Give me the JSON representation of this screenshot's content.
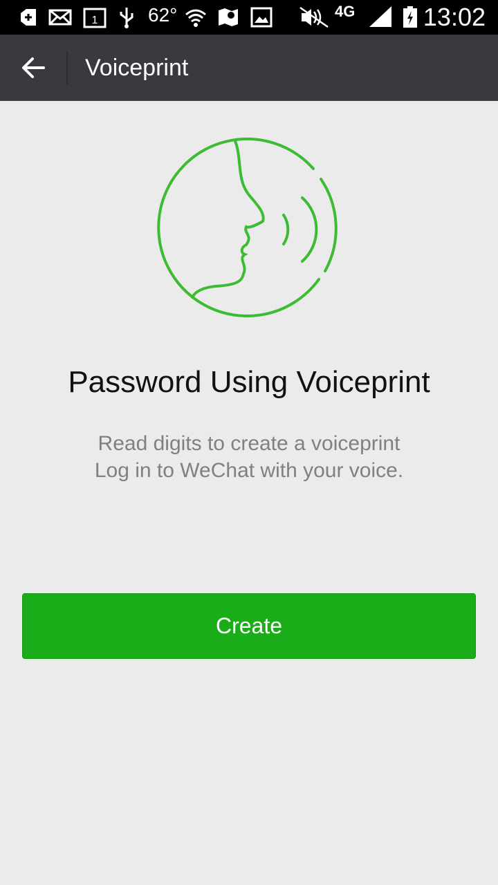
{
  "status_bar": {
    "temperature": "62°",
    "network": "4G",
    "time": "13:02",
    "calendar_day": "1",
    "icons": [
      "plus-icon",
      "mail-icon",
      "calendar-icon",
      "usb-icon",
      "wifi-icon",
      "maps-icon",
      "gallery-icon",
      "mute-icon",
      "signal-icon",
      "battery-icon"
    ]
  },
  "app_bar": {
    "title": "Voiceprint",
    "back_icon": "back-arrow-icon"
  },
  "main": {
    "illustration_icon": "voiceprint-face-icon",
    "headline": "Password Using Voiceprint",
    "subtext_line1": "Read digits to create a voiceprint",
    "subtext_line2": "Log in to WeChat with your voice.",
    "create_label": "Create"
  },
  "colors": {
    "accent_green": "#1aad19",
    "illustration_green": "#3dbc33",
    "app_bar": "#393a3f",
    "background": "#ebebeb"
  }
}
